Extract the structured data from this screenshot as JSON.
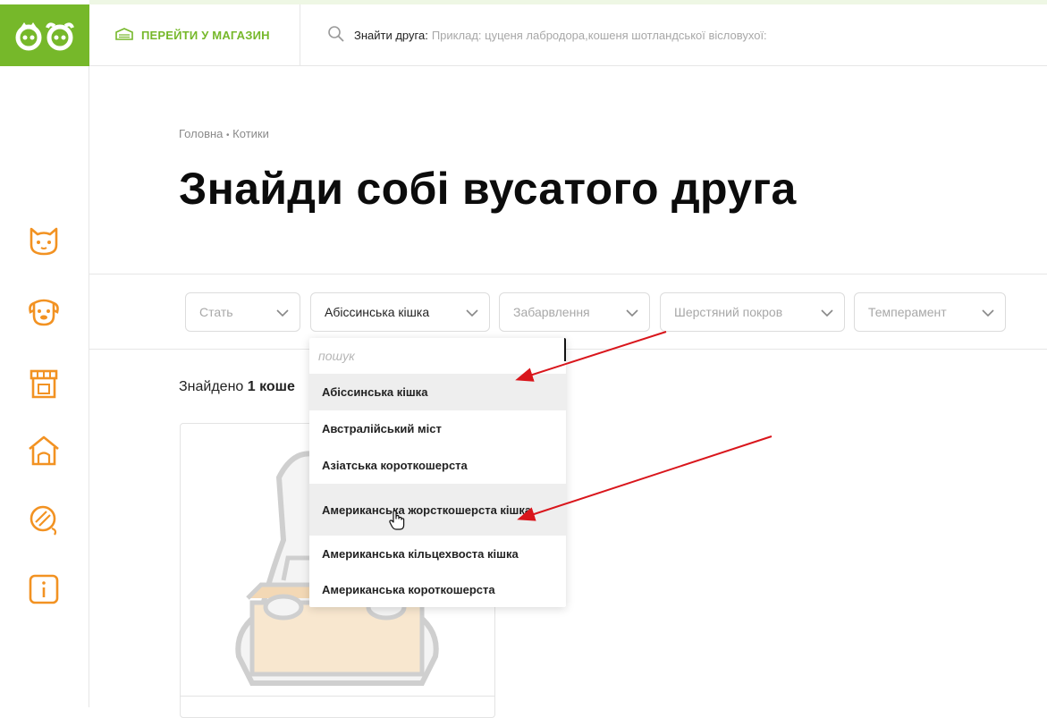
{
  "header": {
    "shop_link_label": "ПЕРЕЙТИ У МАГАЗИН",
    "search_label": "Знайти друга:",
    "search_placeholder": "Приклад: цуценя лабродора,кошеня шотландської вісловухої:"
  },
  "sidebar": {
    "items": [
      {
        "icon": "cat-icon"
      },
      {
        "icon": "dog-icon"
      },
      {
        "icon": "shop-icon"
      },
      {
        "icon": "shelter-icon"
      },
      {
        "icon": "ball-icon"
      },
      {
        "icon": "info-icon"
      }
    ]
  },
  "breadcrumb": {
    "home": "Головна",
    "separator": "•",
    "current": "Котики"
  },
  "page_title": "Знайди собі вусатого друга",
  "filters": [
    {
      "label": "Стать"
    },
    {
      "label": "Абіссинська кішка"
    },
    {
      "label": "Забарвлення"
    },
    {
      "label": "Шерстяний покров"
    },
    {
      "label": "Темперамент"
    }
  ],
  "results": {
    "prefix": "Знайдено",
    "count_text": "1 коше"
  },
  "dropdown": {
    "search_placeholder": "пошук",
    "options": [
      {
        "label": "Абіссинська кішка"
      },
      {
        "label": "Австралійський міст"
      },
      {
        "label": "Азіатська короткошерста"
      },
      {
        "label": "Американська жорсткошерста кішка"
      },
      {
        "label": "Американська кільцехвоста кішка"
      },
      {
        "label": "Американська короткошерста"
      }
    ]
  },
  "colors": {
    "brand_green": "#76b82a",
    "icon_orange": "#f29222",
    "annotation_red": "#d9161c",
    "highlight_bg": "#eeeeee"
  }
}
